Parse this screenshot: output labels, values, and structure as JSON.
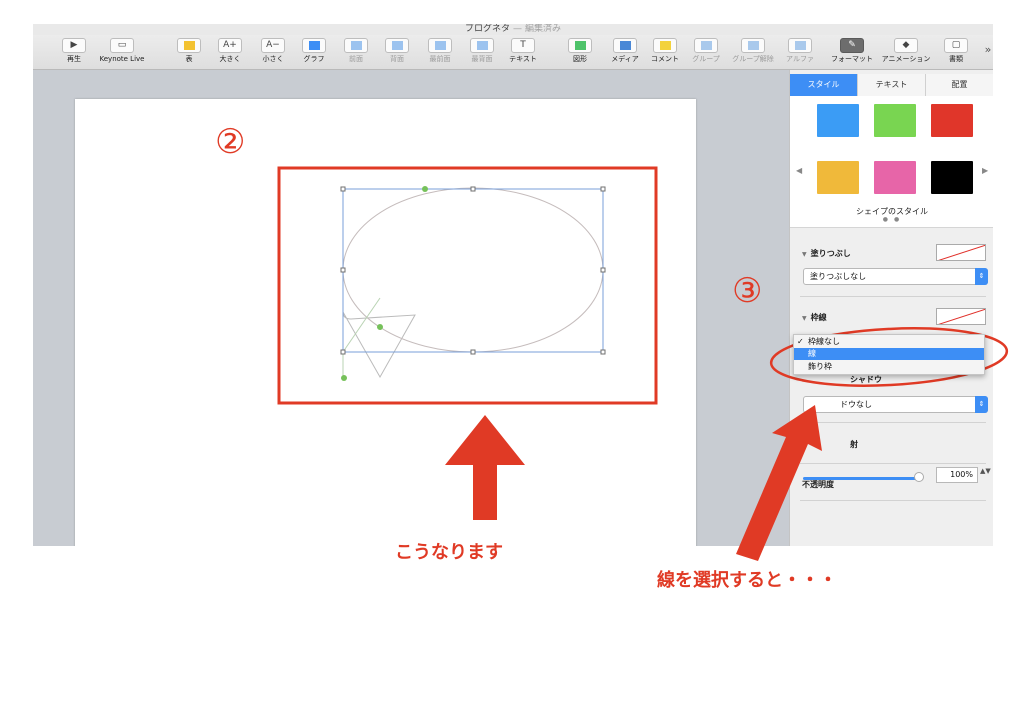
{
  "window": {
    "title": "ブログネタ",
    "separator": "—",
    "state": "編集済み"
  },
  "toolbar": {
    "items": [
      {
        "label": "再生",
        "icon": "play-icon",
        "glyph": "▶"
      },
      {
        "label": "Keynote Live",
        "icon": "keynote-live-icon",
        "glyph": "▭"
      },
      {
        "label": "表",
        "icon": "table-icon",
        "glyph": ""
      },
      {
        "label": "大きく",
        "icon": "font-bigger-icon",
        "glyph": "A+"
      },
      {
        "label": "小さく",
        "icon": "font-smaller-icon",
        "glyph": "A−"
      },
      {
        "label": "グラフ",
        "icon": "chart-icon",
        "glyph": ""
      },
      {
        "label": "前面",
        "icon": "bring-forward-icon",
        "glyph": ""
      },
      {
        "label": "背面",
        "icon": "send-backward-icon",
        "glyph": ""
      },
      {
        "label": "最前面",
        "icon": "bring-to-front-icon",
        "glyph": ""
      },
      {
        "label": "最背面",
        "icon": "send-to-back-icon",
        "glyph": ""
      },
      {
        "label": "テキスト",
        "icon": "text-icon",
        "glyph": "T"
      },
      {
        "label": "図形",
        "icon": "shape-icon",
        "glyph": ""
      },
      {
        "label": "メディア",
        "icon": "media-icon",
        "glyph": ""
      },
      {
        "label": "コメント",
        "icon": "comment-icon",
        "glyph": ""
      },
      {
        "label": "グループ",
        "icon": "group-icon",
        "glyph": ""
      },
      {
        "label": "グループ解除",
        "icon": "ungroup-icon",
        "glyph": ""
      },
      {
        "label": "アルファ",
        "icon": "alpha-icon",
        "glyph": ""
      },
      {
        "label": "フォーマット",
        "icon": "format-brush-icon",
        "glyph": ""
      },
      {
        "label": "アニメーション",
        "icon": "animation-icon",
        "glyph": "◆"
      },
      {
        "label": "書類",
        "icon": "document-icon",
        "glyph": "▢"
      }
    ],
    "more": "»"
  },
  "inspector": {
    "tabs": [
      "スタイル",
      "テキスト",
      "配置"
    ],
    "swatch_colors": [
      "#3b9cf5",
      "#79d551",
      "#e0362a",
      "#f0b93a",
      "#e765a8",
      "#000000"
    ],
    "swatch_caption": "シェイプのスタイル",
    "swatch_dots": "● ●",
    "nav_left": "◀",
    "nav_right": "▶",
    "fill": {
      "label": "塗りつぶし",
      "value": "塗りつぶしなし"
    },
    "stroke": {
      "label": "枠線"
    },
    "stroke_menu": [
      {
        "label": "枠線なし",
        "checked": true
      },
      {
        "label": "線",
        "checked": false
      },
      {
        "label": "飾り枠",
        "checked": false
      }
    ],
    "stroke_menu_check": "✓",
    "shadow": {
      "label_partial": "シャドウ",
      "value_partial": "ドウなし"
    },
    "reflection_partial": "射",
    "opacity": {
      "label": "不透明度",
      "value": "100%"
    }
  },
  "annotations": {
    "step2": "②",
    "step3": "③",
    "caption_result": "こうなります",
    "caption_select": "線を選択すると・・・"
  },
  "colors": {
    "accent": "#3d8ef5",
    "annotation": "#e03a25"
  }
}
